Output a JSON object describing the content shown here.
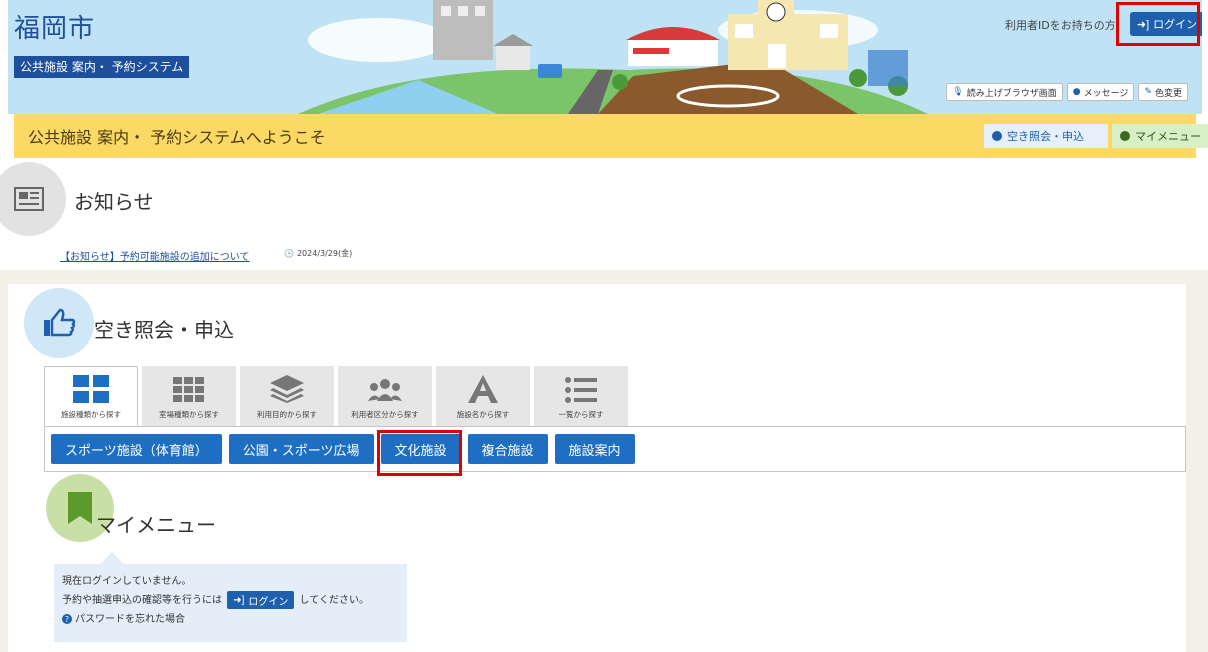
{
  "header": {
    "city_name": "福岡市",
    "system_name": "公共施設 案内・ 予約システム",
    "login_note": "利用者IDをお持ちの方",
    "login_label": "ログイン",
    "utility_buttons": [
      "読み上げブラウザ画面",
      "メッセージ",
      "色変更"
    ]
  },
  "welcome": {
    "title": "公共施設 案内・ 予約システムへようこそ",
    "nav": [
      "空き照会・申込",
      "マイメニュー"
    ]
  },
  "news": {
    "section_title": "お知らせ",
    "items": [
      {
        "title": "【お知らせ】予約可能施設の追加について",
        "date": "2024/3/29(金)"
      }
    ]
  },
  "availability": {
    "section_title": "空き照会・申込",
    "tabs": [
      {
        "label": "施設種類から探す",
        "icon": "grid-icon",
        "active": true
      },
      {
        "label": "室場種類から探す",
        "icon": "grid-small-icon",
        "active": false
      },
      {
        "label": "利用目的から探す",
        "icon": "layers-icon",
        "active": false
      },
      {
        "label": "利用者区分から探す",
        "icon": "users-icon",
        "active": false
      },
      {
        "label": "施設名から探す",
        "icon": "letter-a-icon",
        "active": false
      },
      {
        "label": "一覧から探す",
        "icon": "list-icon",
        "active": false
      }
    ],
    "categories": [
      "スポーツ施設（体育館）",
      "公園・スポーツ広場",
      "文化施設",
      "複合施設",
      "施設案内"
    ]
  },
  "mymenu": {
    "section_title": "マイメニュー",
    "not_logged_in": "現在ログインしていません。",
    "prompt_before": "予約や抽選申込の確認等を行うには",
    "login_label": "ログイン",
    "prompt_after": "してください。",
    "forgot_password": "パスワードを忘れた場合"
  },
  "colors": {
    "brand_blue": "#1e5fae",
    "banner_sky": "#bfe3f5",
    "welcome_yellow": "#fcd964",
    "highlight_red": "#e10000"
  }
}
